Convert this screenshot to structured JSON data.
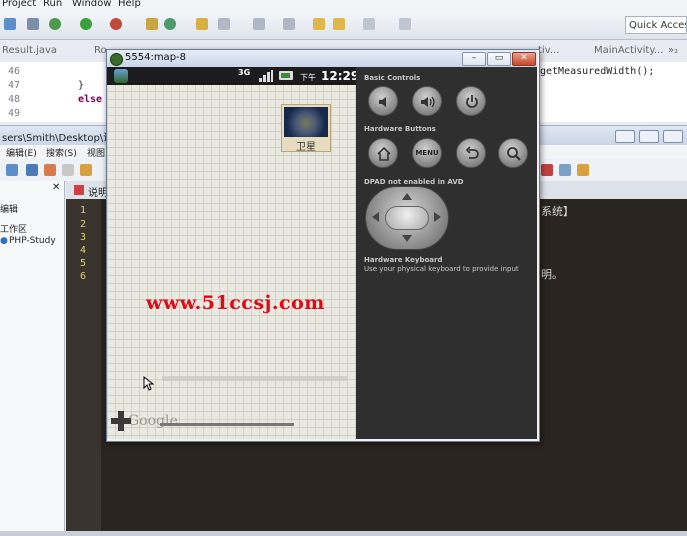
{
  "ide": {
    "menu": [
      "Project",
      "Run",
      "Window",
      "Help"
    ],
    "quick_access": "Quick Access",
    "tabs": [
      "Result.java",
      "Ro",
      "tiv...",
      "MainActivity...",
      "»₂"
    ],
    "line_numbers": [
      "46",
      "47",
      "48",
      "49"
    ],
    "code_lines": [
      "}",
      "else",
      "getMeasuredWidth();"
    ]
  },
  "explorer": {
    "path": "sers\\Smith\\Desktop\\说明",
    "menu": [
      "编辑(E)",
      "搜索(S)",
      "视图"
    ],
    "panel_items": [
      "编辑",
      "工作区",
      "PHP-Study"
    ],
    "editor_tab": "说明",
    "line_numbers": [
      "1",
      "2",
      "3",
      "4",
      "5",
      "6"
    ],
    "code_snippets": [
      "系统】",
      "明。"
    ]
  },
  "emulator": {
    "title": "5554:map-8",
    "status_bar": {
      "network": "3G",
      "ampm": "下午",
      "time": "12:29"
    },
    "satellite_label": "卫星",
    "watermark": "www.51ccsj.com",
    "map_logo": "Google",
    "controls": {
      "basic_label": "Basic Controls",
      "hardware_label": "Hardware Buttons",
      "menu_button": "MENU",
      "dpad_label": "DPAD not enabled in AVD",
      "keyboard_label": "Hardware Keyboard",
      "keyboard_sub": "Use your physical keyboard to provide input"
    }
  },
  "colors": {
    "watermark": "#e00a14",
    "controls_bg": "#2f2f2f",
    "editor_bg": "#2a2520"
  }
}
